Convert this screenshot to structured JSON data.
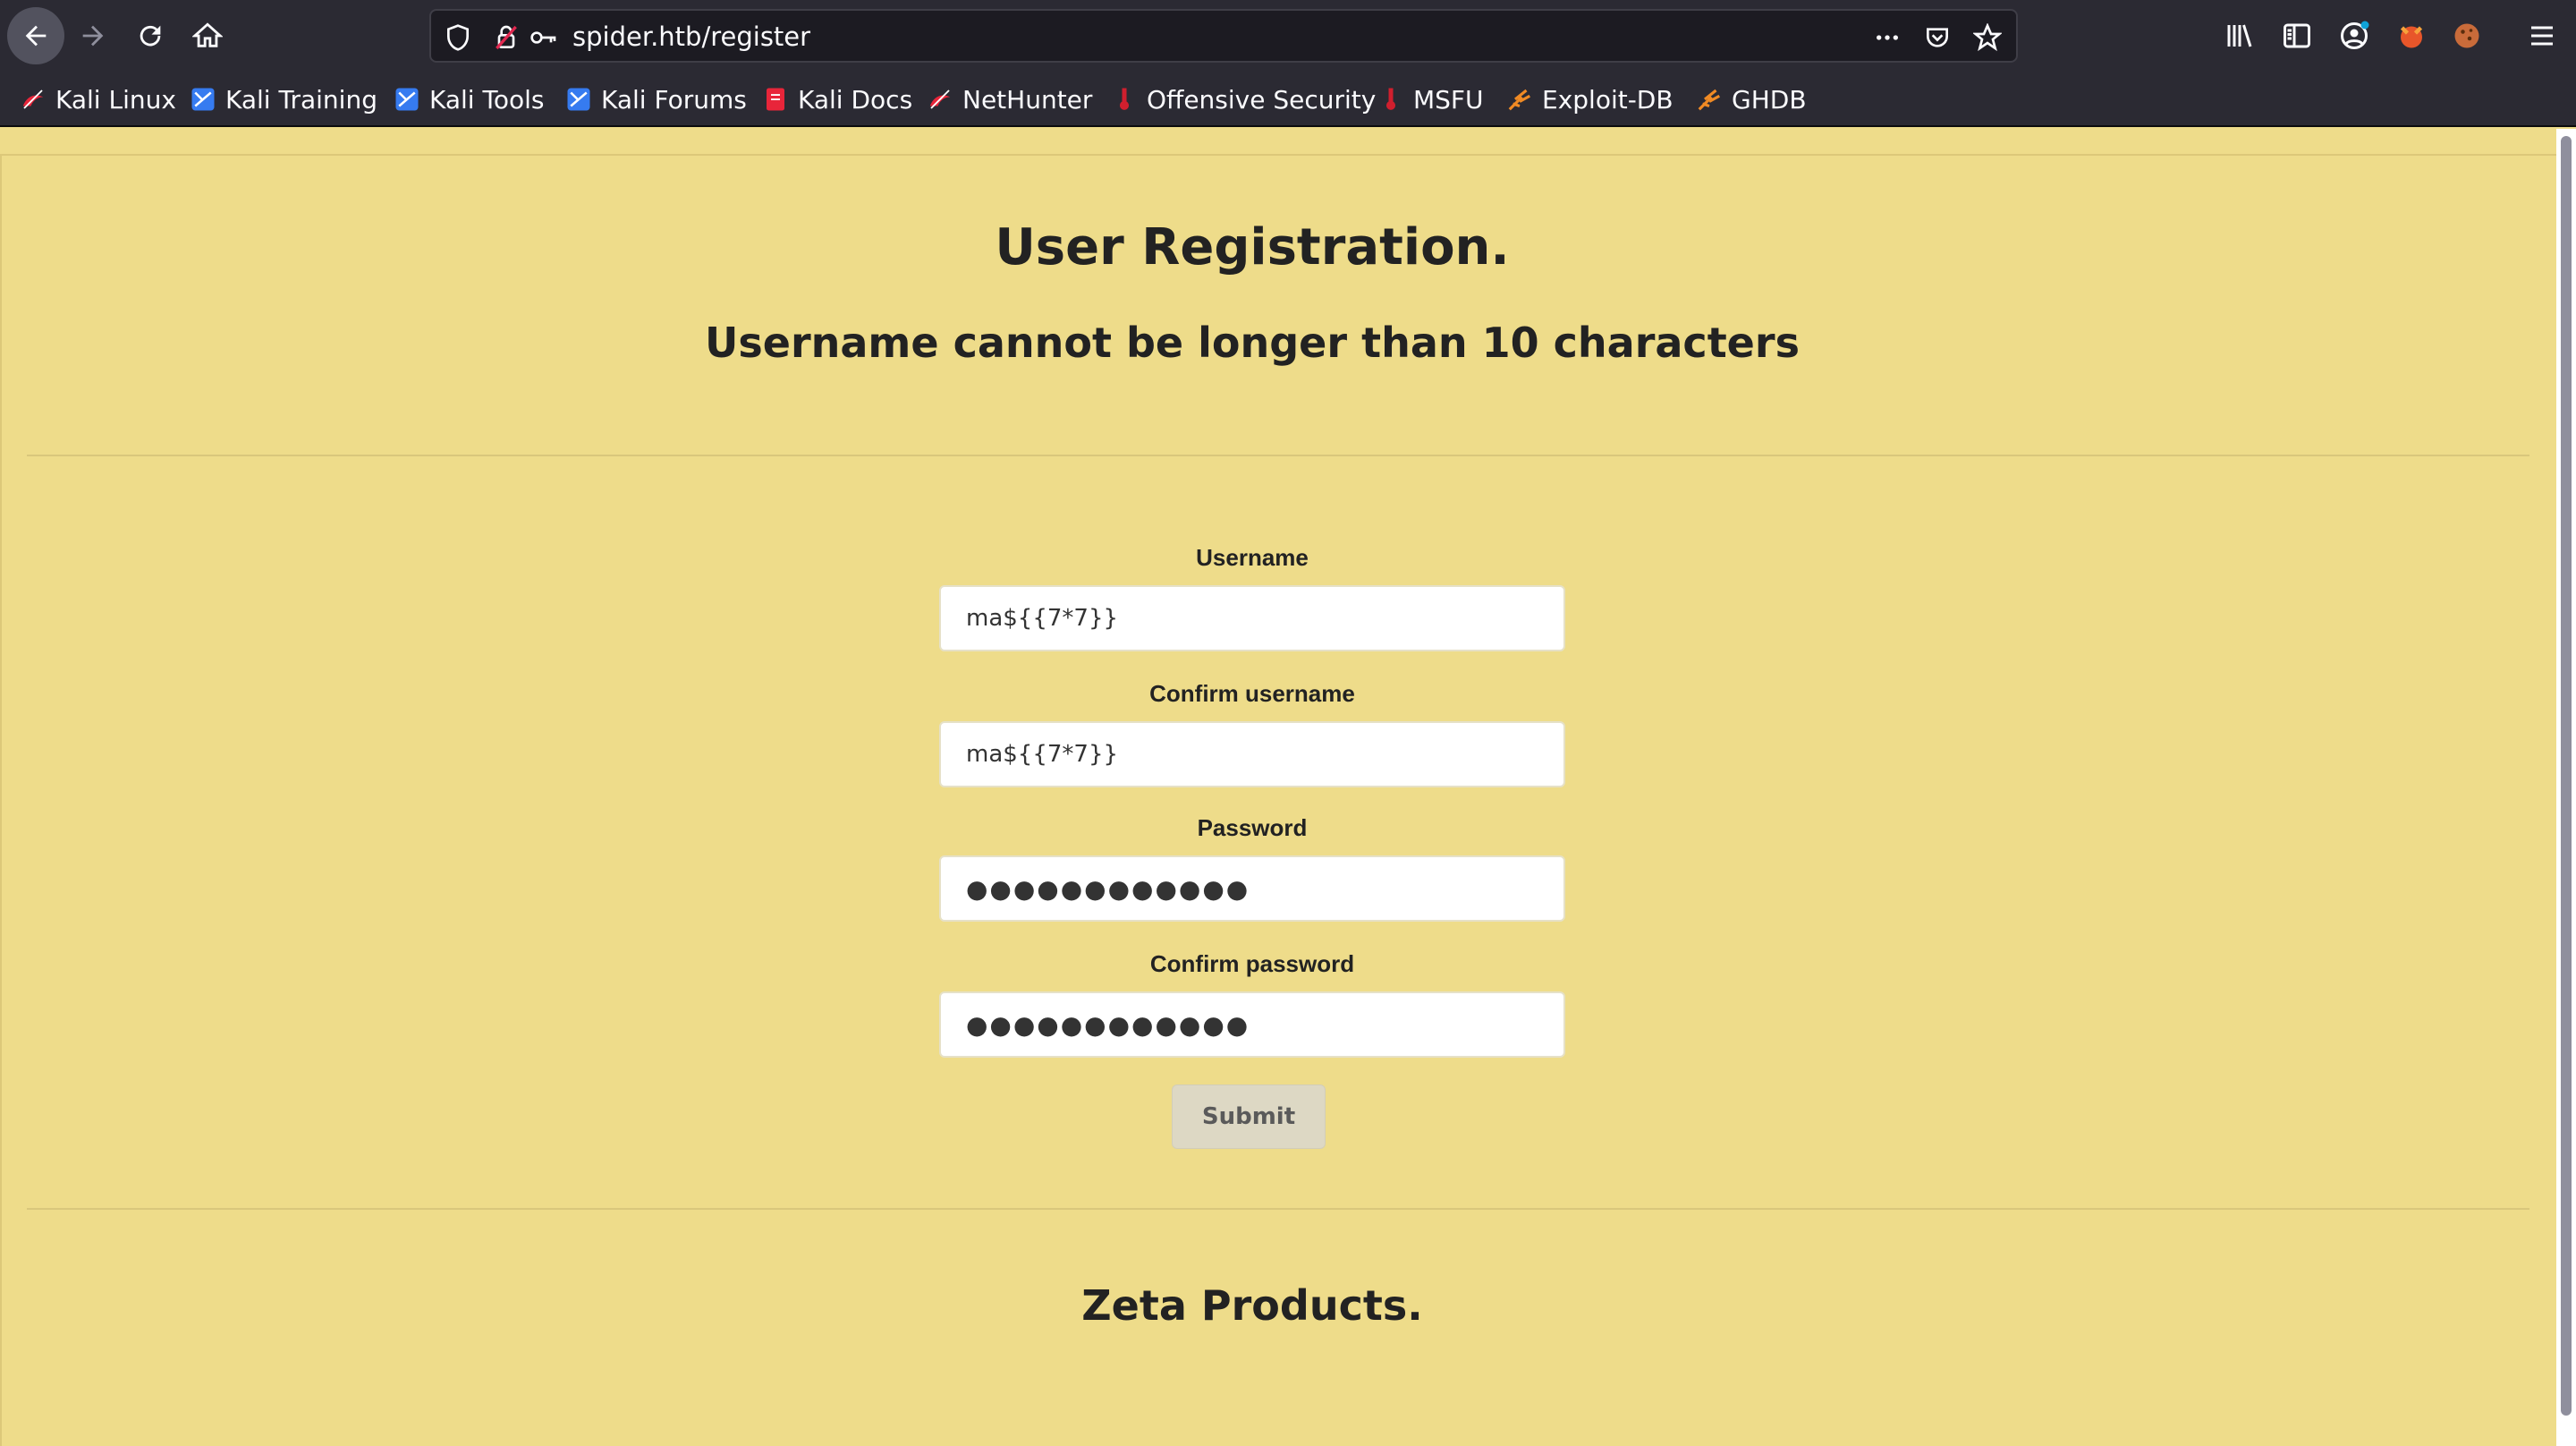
{
  "browser": {
    "url": "spider.htb/register",
    "bookmarks": [
      {
        "label": "Kali Linux",
        "icon": "kali-icon"
      },
      {
        "label": "Kali Training",
        "icon": "kali-training-icon"
      },
      {
        "label": "Kali Tools",
        "icon": "kali-tools-icon"
      },
      {
        "label": "Kali Forums",
        "icon": "kali-forums-icon"
      },
      {
        "label": "Kali Docs",
        "icon": "kali-docs-icon"
      },
      {
        "label": "NetHunter",
        "icon": "nethunter-icon"
      },
      {
        "label": "Offensive Security",
        "icon": "offsec-icon"
      },
      {
        "label": "MSFU",
        "icon": "msfu-icon"
      },
      {
        "label": "Exploit-DB",
        "icon": "exploit-db-icon"
      },
      {
        "label": "GHDB",
        "icon": "ghdb-icon"
      }
    ]
  },
  "page": {
    "title": "User Registration.",
    "subtitle": "Username cannot be longer than 10 characters",
    "form": {
      "username_label": "Username",
      "username_value": "ma${{7*7}}",
      "confirm_username_label": "Confirm username",
      "confirm_username_value": "ma${{7*7}}",
      "password_label": "Password",
      "password_value": "●●●●●●●●●●●●",
      "confirm_password_label": "Confirm password",
      "confirm_password_value": "●●●●●●●●●●●●",
      "submit_label": "Submit"
    },
    "footer_title": "Zeta Products."
  },
  "colors": {
    "page_background": "#eedc8a",
    "toolbar_background": "#2b2a33",
    "text": "#222222"
  }
}
